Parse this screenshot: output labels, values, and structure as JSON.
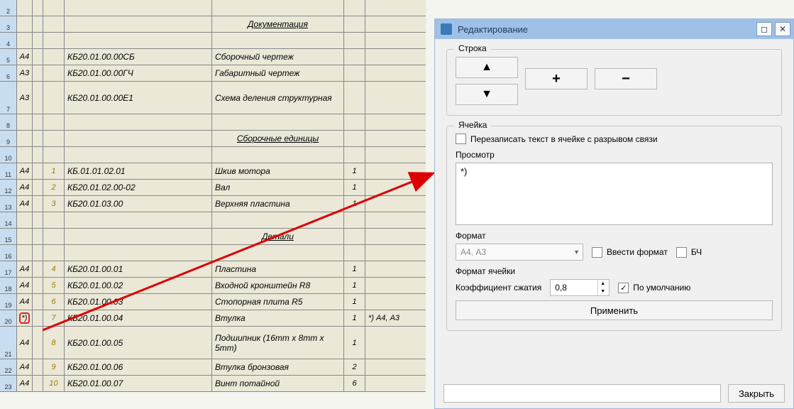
{
  "sheet": {
    "rows": [
      {
        "num": "2",
        "fmt": "",
        "pos": "",
        "code": "",
        "name": "",
        "qty": "",
        "note": ""
      },
      {
        "num": "3",
        "fmt": "",
        "pos": "",
        "code": "",
        "name": "Документация",
        "center": true,
        "qty": "",
        "note": ""
      },
      {
        "num": "4",
        "fmt": "",
        "pos": "",
        "code": "",
        "name": "",
        "qty": "",
        "note": ""
      },
      {
        "num": "5",
        "fmt": "А4",
        "pos": "",
        "code": "КБ20.01.00.00СБ",
        "name": "Сборочный чертеж",
        "qty": "",
        "note": ""
      },
      {
        "num": "6",
        "fmt": "А3",
        "pos": "",
        "code": "КБ20.01.00.00ГЧ",
        "name": "Габаритный чертеж",
        "qty": "",
        "note": ""
      },
      {
        "num": "7",
        "fmt": "А3",
        "pos": "",
        "code": "КБ20.01.00.00Е1",
        "name": "Схема деления структурная",
        "tall": true,
        "qty": "",
        "note": ""
      },
      {
        "num": "8",
        "fmt": "",
        "pos": "",
        "code": "",
        "name": "",
        "qty": "",
        "note": ""
      },
      {
        "num": "9",
        "fmt": "",
        "pos": "",
        "code": "",
        "name": "Сборочные единицы",
        "center": true,
        "qty": "",
        "note": ""
      },
      {
        "num": "10",
        "fmt": "",
        "pos": "",
        "code": "",
        "name": "",
        "qty": "",
        "note": ""
      },
      {
        "num": "11",
        "fmt": "А4",
        "pos": "1",
        "code": "КБ.01.01.02.01",
        "name": "Шкив мотора",
        "qty": "1",
        "note": ""
      },
      {
        "num": "12",
        "fmt": "А4",
        "pos": "2",
        "code": "КБ20.01.02.00-02",
        "name": "Вал",
        "qty": "1",
        "note": ""
      },
      {
        "num": "13",
        "fmt": "А4",
        "pos": "3",
        "code": "КБ20.01.03.00",
        "name": "Верхняя пластина",
        "qty": "1",
        "note": ""
      },
      {
        "num": "14",
        "fmt": "",
        "pos": "",
        "code": "",
        "name": "",
        "qty": "",
        "note": ""
      },
      {
        "num": "15",
        "fmt": "",
        "pos": "",
        "code": "",
        "name": "Детали",
        "center": true,
        "qty": "",
        "note": ""
      },
      {
        "num": "16",
        "fmt": "",
        "pos": "",
        "code": "",
        "name": "",
        "qty": "",
        "note": ""
      },
      {
        "num": "17",
        "fmt": "А4",
        "pos": "4",
        "code": "КБ20.01.00.01",
        "name": "Пластина",
        "qty": "1",
        "note": ""
      },
      {
        "num": "18",
        "fmt": "А4",
        "pos": "5",
        "code": "КБ20.01.00.02",
        "name": "Входной кронштейн R8",
        "qty": "1",
        "note": ""
      },
      {
        "num": "19",
        "fmt": "А4",
        "pos": "6",
        "code": "КБ20.01.00.03",
        "name": "Стопорная плита R5",
        "qty": "1",
        "note": ""
      },
      {
        "num": "20",
        "fmt": "*)",
        "hl": true,
        "pos": "7",
        "code": "КБ20.01.00.04",
        "name": "Втулка",
        "qty": "1",
        "note": "*) А4, А3"
      },
      {
        "num": "21",
        "fmt": "А4",
        "pos": "8",
        "code": "КБ20.01.00.05",
        "name": "Подшипник (16mm x 8mm x 5mm)",
        "tall": true,
        "qty": "1",
        "note": ""
      },
      {
        "num": "22",
        "fmt": "А4",
        "pos": "9",
        "code": "КБ20.01.00.06",
        "name": "Втулка бронзовая",
        "qty": "2",
        "note": ""
      },
      {
        "num": "23",
        "fmt": "А4",
        "pos": "10",
        "code": "КБ20.01.00.07",
        "name": "Винт потайной",
        "qty": "6",
        "note": ""
      }
    ]
  },
  "dialog": {
    "title": "Редактирование",
    "group_row": "Строка",
    "group_cell": "Ячейка",
    "chk_overwrite": "Перезаписать текст в ячейке с разрывом связи",
    "lbl_preview": "Просмотр",
    "preview_text": "*)",
    "lbl_format": "Формат",
    "format_value": "А4, А3",
    "chk_enter_format": "Ввести формат",
    "chk_bch": "БЧ",
    "lbl_cellfmt": "Формат ячейки",
    "lbl_coef": "Коэффициент сжатия",
    "coef_value": "0,8",
    "chk_default": "По умолчанию",
    "btn_apply": "Применить",
    "btn_close": "Закрыть"
  }
}
